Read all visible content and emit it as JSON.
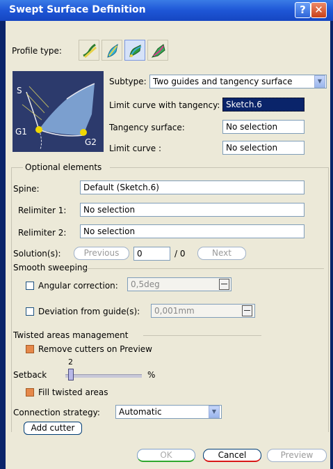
{
  "window": {
    "title": "Swept Surface Definition",
    "help": "?",
    "close": "✕"
  },
  "profile_type": {
    "label": "Profile type:",
    "icons": [
      "line-profile-icon",
      "circle-profile-icon",
      "conic-profile-icon",
      "explicit-profile-icon"
    ],
    "active_index": 2
  },
  "diagram": {
    "labels": [
      "S",
      "G1",
      "G2"
    ]
  },
  "subtype": {
    "label": "Subtype:",
    "value": "Two guides and tangency surface"
  },
  "limit_curve_tangency": {
    "label": "Limit curve with tangency:",
    "value": "Sketch.6"
  },
  "tangency_surface": {
    "label": "Tangency surface:",
    "value": "No selection"
  },
  "limit_curve": {
    "label": "Limit curve :",
    "value": "No selection"
  },
  "optional": {
    "title": "Optional elements",
    "spine": {
      "label": "Spine:",
      "value": "Default (Sketch.6)"
    },
    "relimiter1": {
      "label": "Relimiter 1:",
      "value": "No selection"
    },
    "relimiter2": {
      "label": "Relimiter 2:",
      "value": "No selection"
    },
    "solutions": {
      "label": "Solution(s):",
      "previous": "Previous",
      "value": "0",
      "total": "/ 0",
      "next": "Next"
    }
  },
  "smooth": {
    "title": "Smooth sweeping",
    "angular": {
      "label": "Angular correction:",
      "value": "0,5deg",
      "checked": false
    },
    "deviation": {
      "label": "Deviation from guide(s):",
      "value": "0,001mm",
      "checked": false
    }
  },
  "twisted": {
    "title": "Twisted areas management",
    "remove_cutters": {
      "label": "Remove cutters on Preview",
      "checked": true
    },
    "setback": {
      "label": "Setback",
      "value": "2",
      "unit": "%",
      "fraction": 0.02
    },
    "fill_twisted": {
      "label": "Fill twisted areas",
      "checked": true
    },
    "connection": {
      "label": "Connection strategy:",
      "value": "Automatic"
    },
    "add_cutter": "Add cutter"
  },
  "buttons": {
    "ok": "OK",
    "cancel": "Cancel",
    "preview": "Preview"
  }
}
